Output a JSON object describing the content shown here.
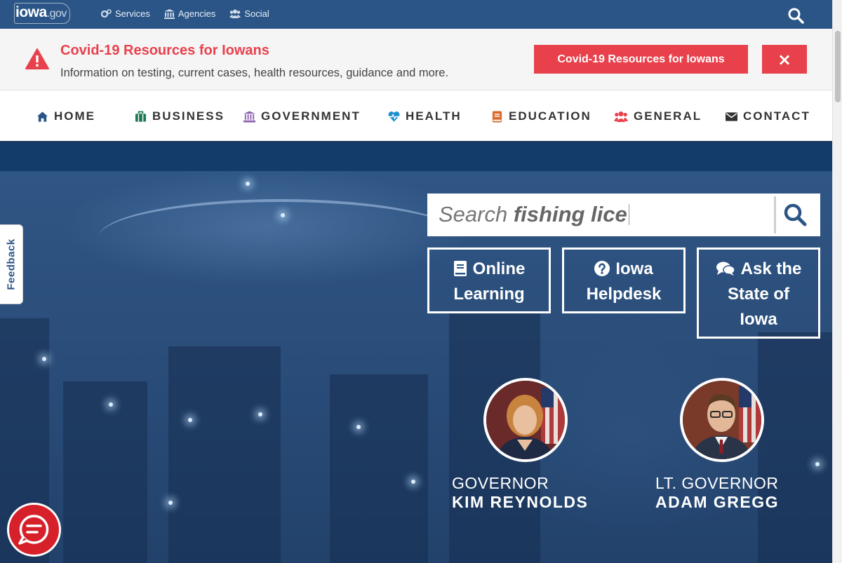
{
  "topbar": {
    "logo_main": "iowa",
    "logo_suffix": ".gov",
    "links": [
      {
        "label": "Services",
        "icon": "gears-icon"
      },
      {
        "label": "Agencies",
        "icon": "building-icon"
      },
      {
        "label": "Social",
        "icon": "users-icon"
      }
    ]
  },
  "banner": {
    "title": "Covid-19 Resources for Iowans",
    "text": "Information on testing, current cases, health resources, guidance and more.",
    "button_label": "Covid-19 Resources for Iowans",
    "close_label": "×"
  },
  "nav": {
    "items": [
      {
        "label": "HOME",
        "icon": "home-icon",
        "color": "#2b5586"
      },
      {
        "label": "BUSINESS",
        "icon": "briefcase-icon",
        "color": "#1f7a55"
      },
      {
        "label": "GOVERNMENT",
        "icon": "government-icon",
        "color": "#8a63b0"
      },
      {
        "label": "HEALTH",
        "icon": "heartbeat-icon",
        "color": "#1f8fd0"
      },
      {
        "label": "EDUCATION",
        "icon": "book-icon",
        "color": "#d96a2b"
      },
      {
        "label": "GENERAL",
        "icon": "users-icon",
        "color": "#e8414c"
      },
      {
        "label": "CONTACT",
        "icon": "envelope-icon",
        "color": "#333333"
      }
    ]
  },
  "search": {
    "prefix": "Search ",
    "typed": "fishing lice"
  },
  "quick_links": [
    {
      "label": "Online Learning",
      "line1": "Online",
      "line2": "Learning",
      "line3": "",
      "icon": "book-icon"
    },
    {
      "label": "Iowa Helpdesk",
      "line1": "Iowa",
      "line2": "Helpdesk",
      "line3": "",
      "icon": "question-circle-icon"
    },
    {
      "label": "Ask the State of Iowa",
      "line1": "Ask the",
      "line2": "State of",
      "line3": "Iowa",
      "icon": "comments-icon"
    }
  ],
  "officials": [
    {
      "title": "GOVERNOR",
      "name": "KIM REYNOLDS"
    },
    {
      "title": "LT. GOVERNOR",
      "name": "ADAM GREGG"
    }
  ],
  "feedback": {
    "label": "Feedback"
  },
  "colors": {
    "topbar": "#2b5586",
    "alert_red": "#e8414c",
    "nav_text": "#333333",
    "hero_strip": "#133c6b"
  }
}
